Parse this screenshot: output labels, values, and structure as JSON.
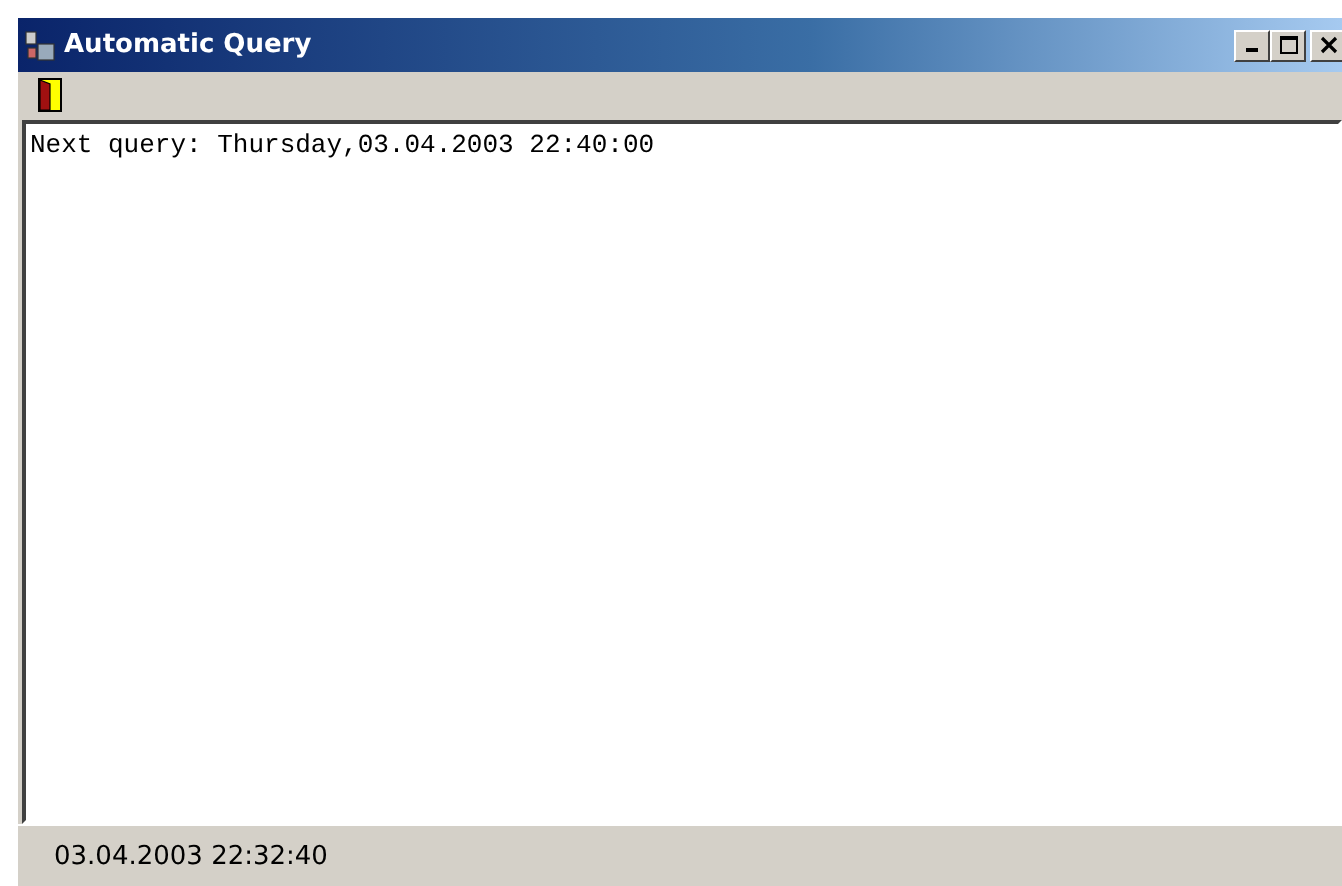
{
  "window": {
    "title": "Automatic Query"
  },
  "toolbar": {
    "buttons": [
      {
        "kind": "exit"
      }
    ]
  },
  "log": {
    "lines": [
      "Next query: Thursday,03.04.2003 22:40:00"
    ]
  },
  "status_bar": {
    "text": "03.04.2003 22:32:40"
  }
}
